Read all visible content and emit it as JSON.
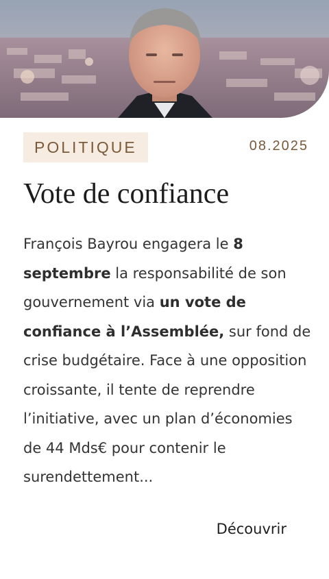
{
  "hero": {
    "image": "portrait-over-paris-skyline"
  },
  "article": {
    "category": "POLITIQUE",
    "date": "08.2025",
    "title": "Vote de confiance",
    "body": {
      "p1": "François Bayrou engagera le ",
      "b1": "8 septembre",
      "p2": " la responsabilité de son gouvernement via ",
      "b2": "un vote de confiance à l’Assemblée,",
      "p3": " sur fond de crise budgétaire. Face à une opposition croissante, il tente de reprendre l’initiative, avec un plan d’économies de 44 Mds€ pour contenir le surendettement..."
    },
    "cta": "Découvrir"
  },
  "colors": {
    "tag_bg": "#f6ece2",
    "accent": "#7a5a3a",
    "text": "#333333"
  }
}
